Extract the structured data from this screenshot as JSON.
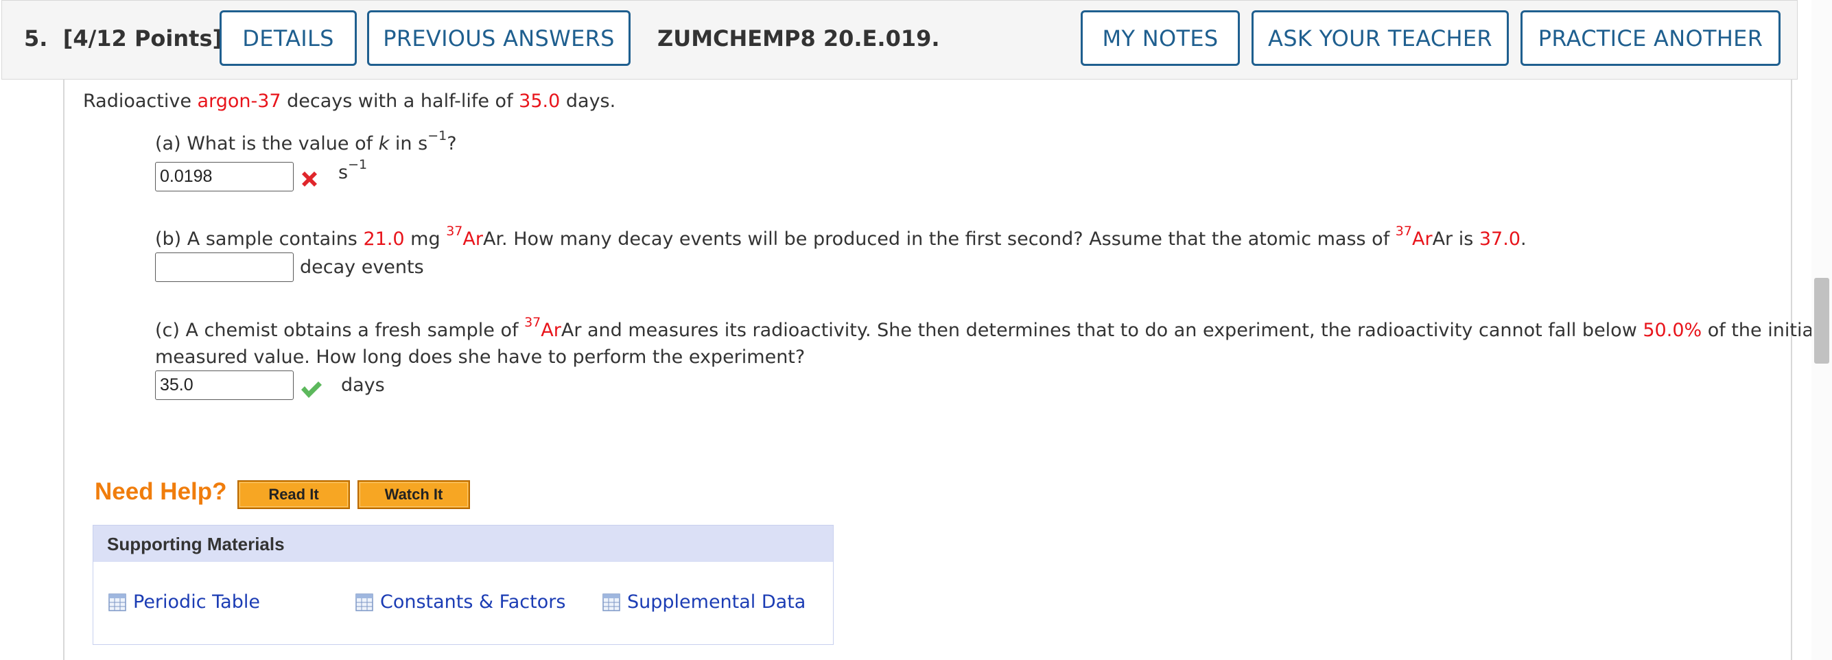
{
  "header": {
    "question_number": "5.",
    "points": "[4/12 Points]",
    "details_label": "DETAILS",
    "previous_answers_label": "PREVIOUS ANSWERS",
    "question_code": "ZUMCHEMP8 20.E.019.",
    "my_notes_label": "MY NOTES",
    "ask_teacher_label": "ASK YOUR TEACHER",
    "practice_another_label": "PRACTICE ANOTHER"
  },
  "intro": {
    "t1": "Radioactive ",
    "isotope": "argon-37",
    "t2": " decays with a half-life of ",
    "half_life": "35.0",
    "t3": " days."
  },
  "part_a": {
    "t1": "(a) What is the value of ",
    "k": "k",
    "t2": " in s",
    "exp": "−1",
    "t3": "?",
    "answer": "0.0198",
    "status": "incorrect",
    "unit": "s",
    "unit_exp": "−1"
  },
  "part_b": {
    "t1": "(b) A sample contains ",
    "mass": "21.0",
    "t2": " mg ",
    "sup1": "37",
    "t3": "Ar. How many decay events will be produced in the first second? Assume that the atomic mass of ",
    "sup2": "37",
    "t4": "Ar is ",
    "atomic_mass": "37.0",
    "t5": ".",
    "answer": "",
    "unit": "decay events"
  },
  "part_c": {
    "t1": "(c) A chemist obtains a fresh sample of ",
    "sup1": "37",
    "t2": "Ar and measures its radioactivity. She then determines that to do an experiment, the radioactivity cannot fall below ",
    "percent": "50.0%",
    "t3": " of the initial",
    "line2": "measured value. How long does she have to perform the experiment?",
    "answer": "35.0",
    "status": "correct",
    "unit": "days"
  },
  "help": {
    "label": "Need Help?",
    "read_it": "Read It",
    "watch_it": "Watch It"
  },
  "supporting": {
    "title": "Supporting Materials",
    "links": [
      "Periodic Table",
      "Constants & Factors",
      "Supplemental Data"
    ]
  },
  "colors": {
    "accent_blue": "#1f5f8f",
    "variable_red": "#e8141b",
    "help_orange": "#f07d0c",
    "correct_green": "#5cb85c",
    "incorrect_red": "#e0262b"
  }
}
